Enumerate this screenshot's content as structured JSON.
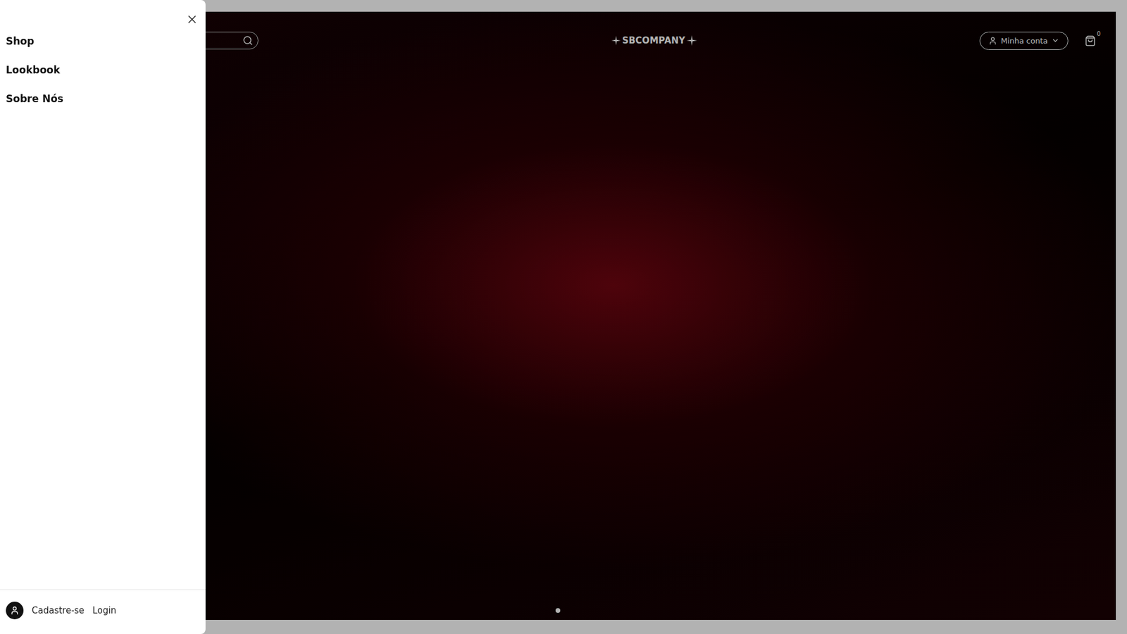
{
  "drawer": {
    "menu": [
      {
        "label": "Shop"
      },
      {
        "label": "Lookbook"
      },
      {
        "label": "Sobre Nós"
      }
    ],
    "footer_links": [
      "Cadastre-se",
      "Login"
    ]
  },
  "header": {
    "logo": "SBCOMPANY",
    "account": "Minha conta",
    "cart_count": "0"
  },
  "carousel": {
    "dots": [
      {
        "selected": true
      }
    ]
  }
}
